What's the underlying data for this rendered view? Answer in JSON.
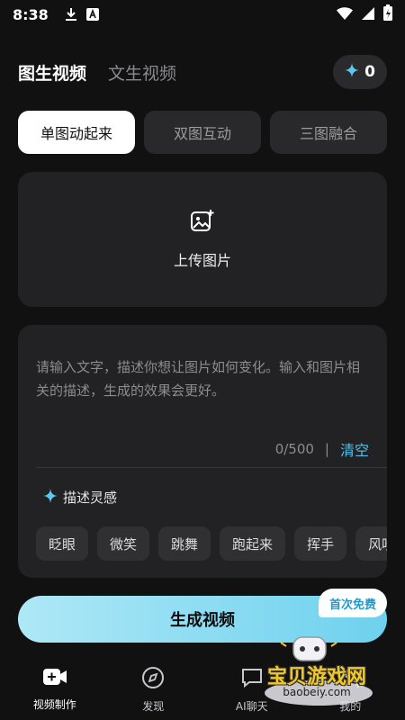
{
  "status_bar": {
    "time": "8:38"
  },
  "header": {
    "tab_image_video": "图生视频",
    "tab_text_video": "文生视频",
    "credits": "0"
  },
  "modes": [
    {
      "label": "单图动起来",
      "active": true
    },
    {
      "label": "双图互动",
      "active": false
    },
    {
      "label": "三图融合",
      "active": false
    }
  ],
  "upload": {
    "label": "上传图片"
  },
  "prompt": {
    "placeholder": "请输入文字，描述你想让图片如何变化。输入和图片相关的描述，生成的效果会更好。",
    "counter": "0/500",
    "separator": "|",
    "clear_label": "清空",
    "inspire_label": "描述灵感",
    "chips": [
      "眨眼",
      "微笑",
      "跳舞",
      "跑起来",
      "挥手",
      "风吹"
    ]
  },
  "generate": {
    "label": "生成视频",
    "badge": "首次免费"
  },
  "bottom_nav": [
    {
      "label": "视频制作",
      "icon": "video-icon",
      "active": true
    },
    {
      "label": "发现",
      "icon": "compass-icon",
      "active": false
    },
    {
      "label": "AI聊天",
      "icon": "chat-icon",
      "active": false
    },
    {
      "label": "我的",
      "icon": "user-icon",
      "active": false
    }
  ],
  "watermark": {
    "title": "宝贝游戏网",
    "site": "baobeiy.com"
  },
  "colors": {
    "accent": "#4fc1ea",
    "background": "#111112",
    "card": "#222224"
  }
}
